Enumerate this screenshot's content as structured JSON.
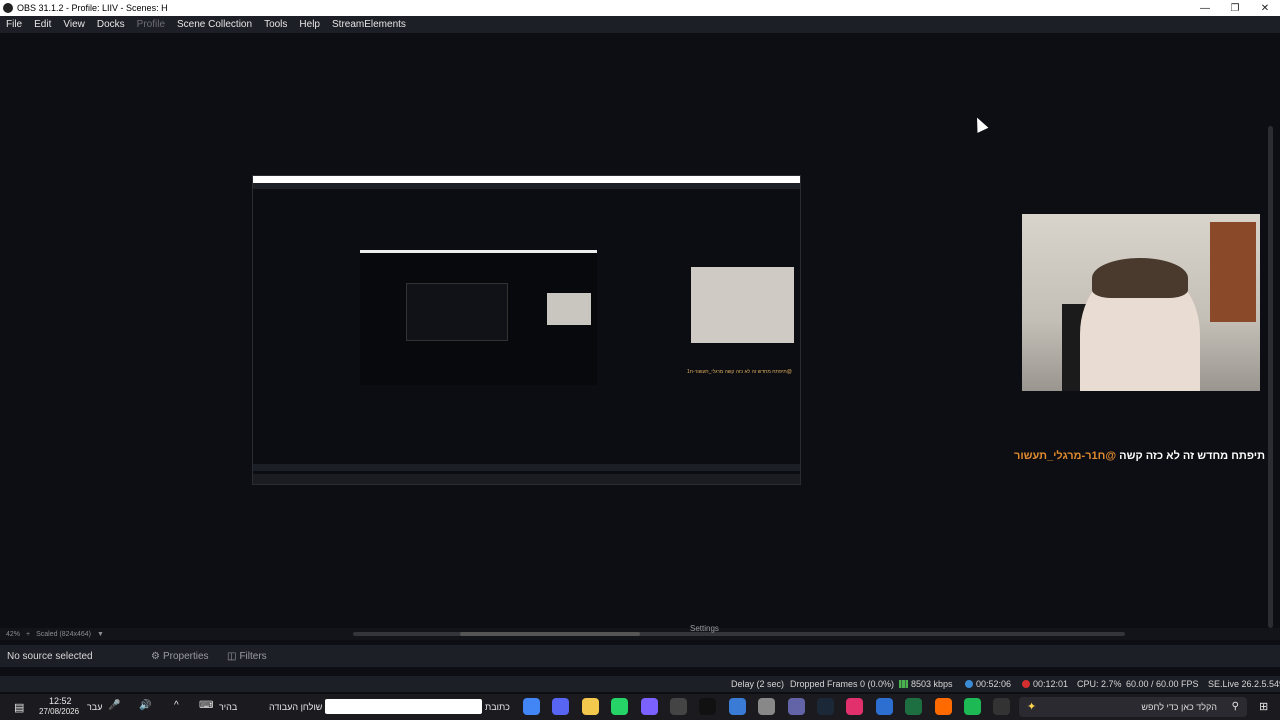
{
  "window": {
    "title": "OBS 31.1.2 - Profile: LIIV - Scenes: H"
  },
  "menu": {
    "items": [
      {
        "label": "File",
        "disabled": false
      },
      {
        "label": "Edit",
        "disabled": false
      },
      {
        "label": "View",
        "disabled": false
      },
      {
        "label": "Docks",
        "disabled": false
      },
      {
        "label": "Profile",
        "disabled": true
      },
      {
        "label": "Scene Collection",
        "disabled": false
      },
      {
        "label": "Tools",
        "disabled": false
      },
      {
        "label": "Help",
        "disabled": false
      },
      {
        "label": "StreamElements",
        "disabled": false
      }
    ]
  },
  "preview": {
    "chat_user": "@ח1ר-מרגלי_תעשור",
    "chat_message": "תיפתח מחדש זה לא כזה קשה",
    "nested_chat": "תיפתח מחדש זה לא כזה קשה מרגלי_תעשור-ח1@"
  },
  "zoom": {
    "level": "42%",
    "scaled": "Scaled (824x464)",
    "settings_label": "Settings"
  },
  "context": {
    "no_source": "No source selected",
    "properties": "Properties",
    "filters": "Filters"
  },
  "status": {
    "delay": "Delay (2 sec)",
    "dropped": "Dropped Frames 0 (0.0%)",
    "bitrate": "8503 kbps",
    "stream_time": "00:52:06",
    "rec_time": "00:12:01",
    "cpu": "CPU: 2.7%",
    "fps": "60.00 / 60.00 FPS",
    "version": "SE.Live 26.2.5.549",
    "colors": {
      "bitrate": "#4caf50",
      "stream": "#3b8cd4",
      "rec": "#d32f2f"
    }
  },
  "taskbar": {
    "time": "12:52",
    "date": "27/08/2026",
    "lang": "עבר",
    "bright": "בהיר",
    "desktop": "שולחן העבודה",
    "address": "כתובת",
    "search_placeholder": "הקלד כאן כדי לחפש",
    "app_icons": [
      "chrome-icon",
      "discord-icon",
      "folder-icon",
      "whatsapp-icon",
      "copilot-icon",
      "obs-icon",
      "capcut-icon",
      "notepad-icon",
      "browser-icon",
      "teams-icon",
      "steam-icon",
      "instagram-icon",
      "calculator-icon",
      "excel-icon",
      "steelseries-icon",
      "spotify-icon",
      "epic-icon"
    ]
  }
}
